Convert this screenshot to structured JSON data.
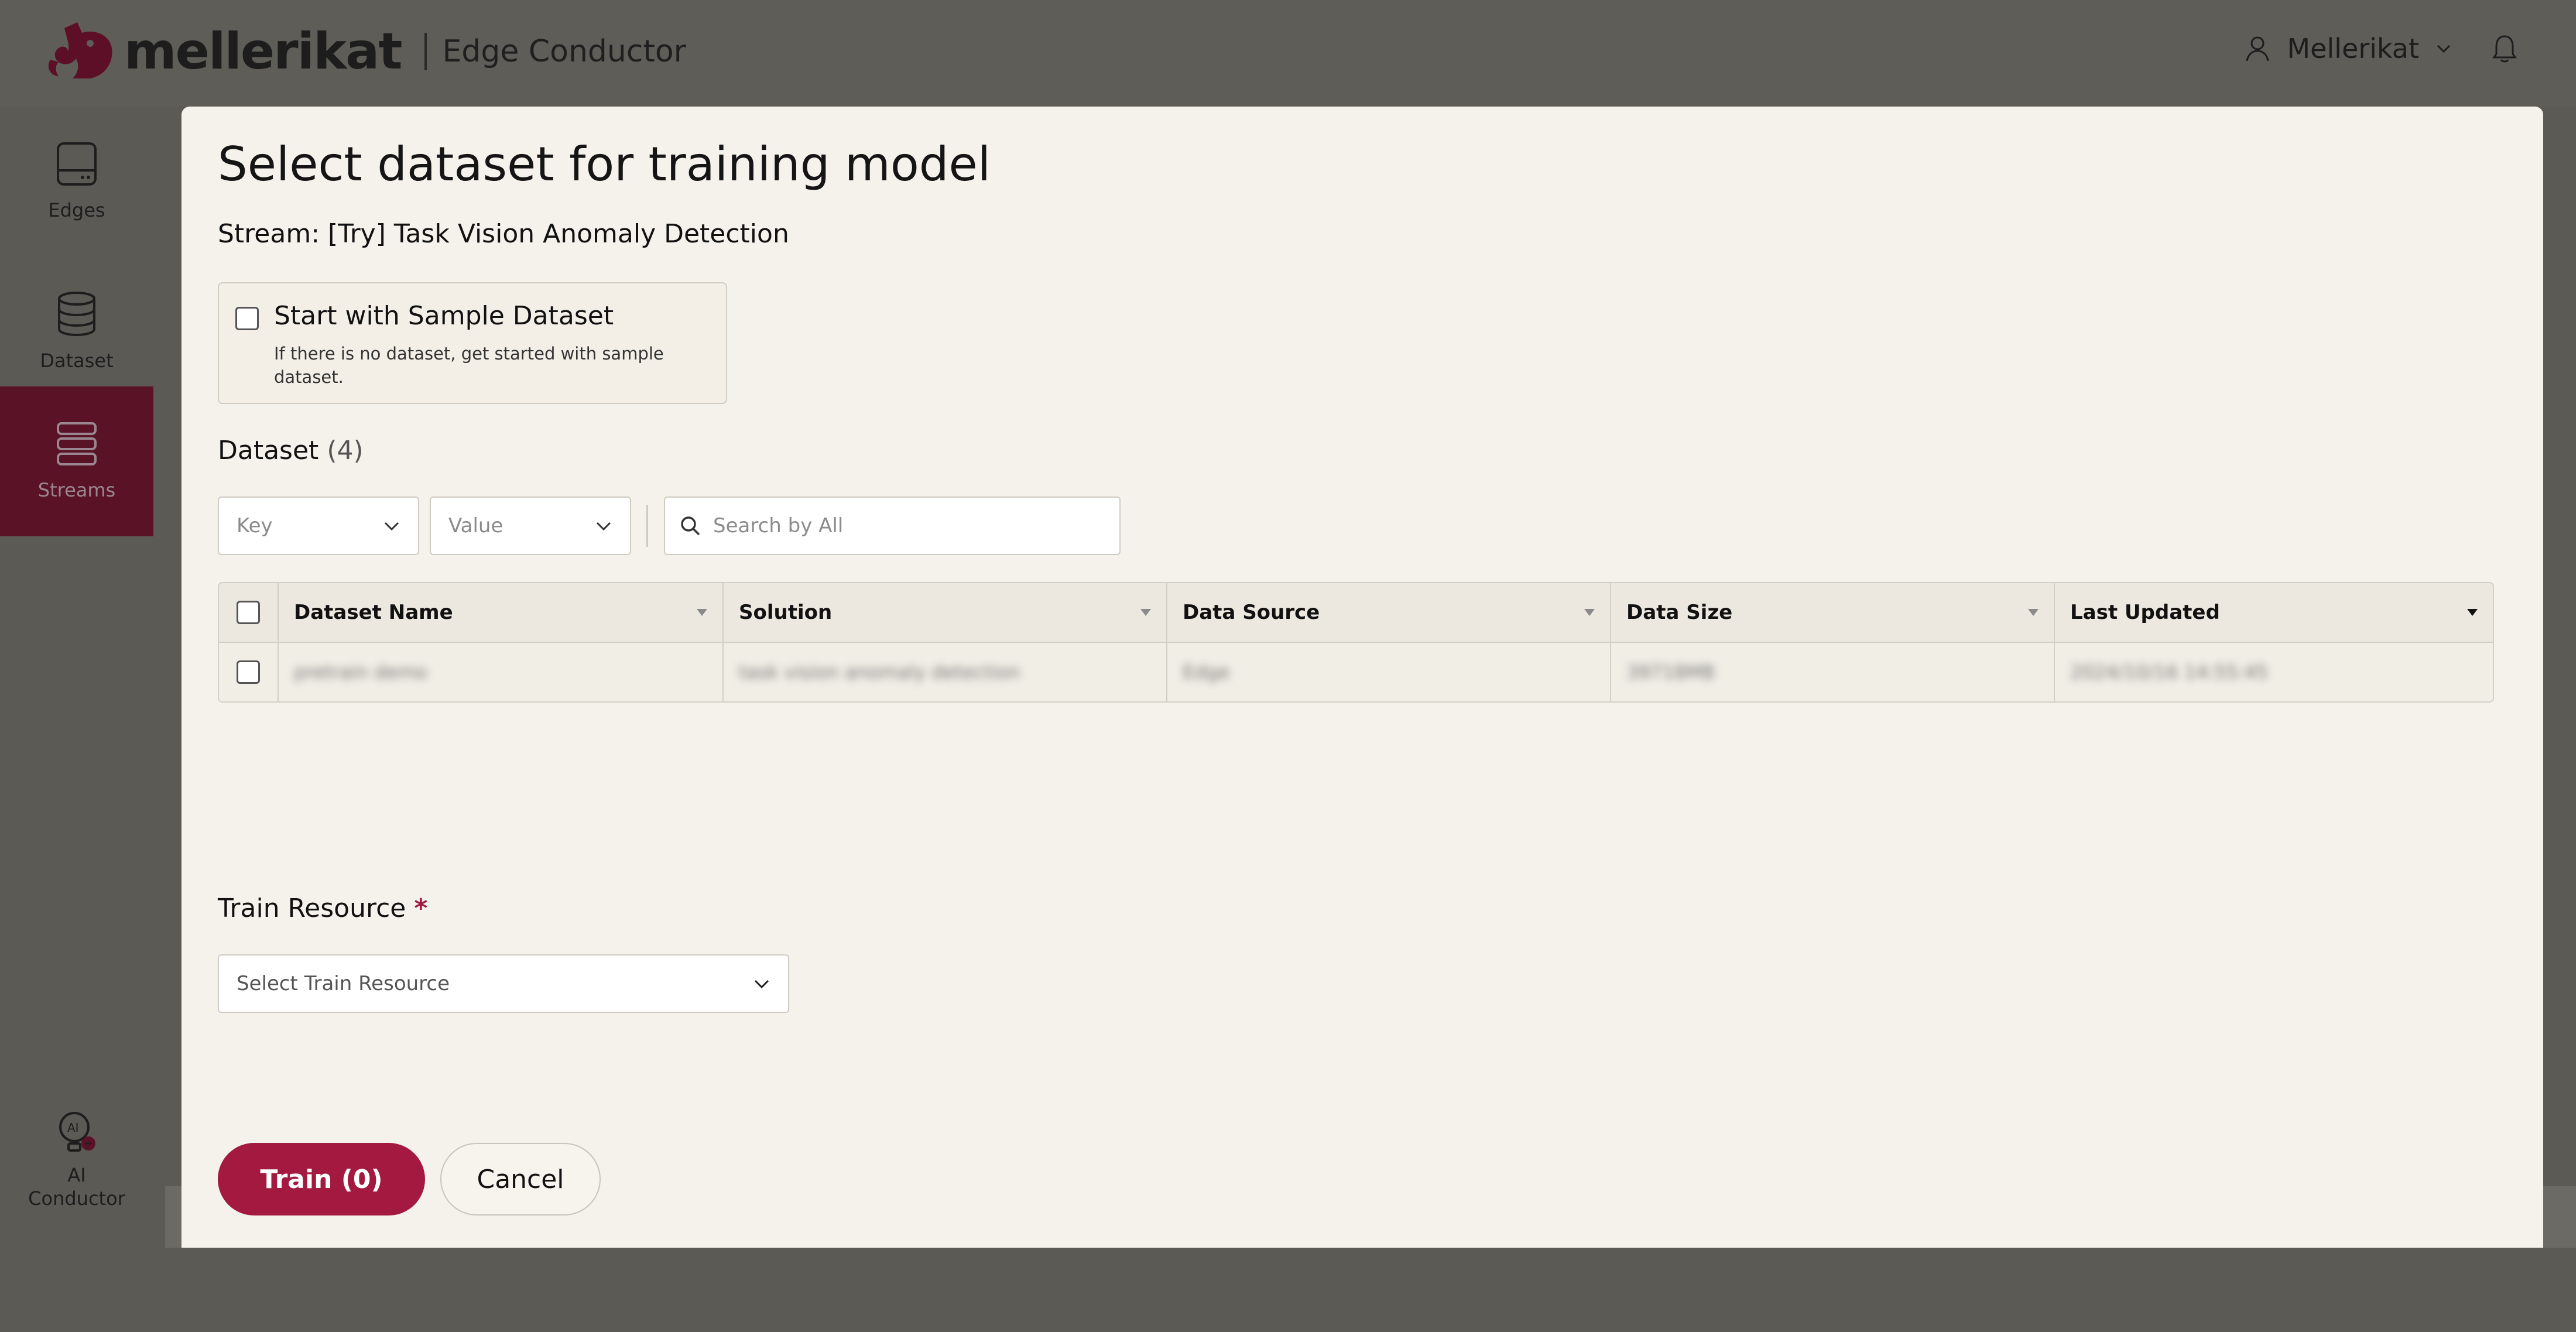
{
  "header": {
    "brand": "mellerikat",
    "product": "Edge Conductor",
    "user_name": "Mellerikat"
  },
  "sidebar": {
    "items": [
      {
        "label": "Edges",
        "icon": "edge-device-icon",
        "active": false
      },
      {
        "label": "Dataset",
        "icon": "database-icon",
        "active": false
      },
      {
        "label": "Streams",
        "icon": "streams-icon",
        "active": true
      }
    ],
    "ai_conductor": {
      "label_line1": "AI",
      "label_line2": "Conductor",
      "icon": "ai-bulb-icon"
    }
  },
  "modal": {
    "title": "Select dataset for training model",
    "stream_line": "Stream: [Try] Task Vision Anomaly Detection",
    "sample": {
      "title": "Start with Sample Dataset",
      "description": "If there is no dataset, get started with sample dataset.",
      "checked": false
    },
    "dataset_heading": "Dataset",
    "dataset_count": "(4)",
    "filters": {
      "key_placeholder": "Key",
      "value_placeholder": "Value",
      "search_placeholder": "Search by All"
    },
    "table": {
      "columns": [
        "Dataset Name",
        "Solution",
        "Data Source",
        "Data Size",
        "Last Updated"
      ],
      "rows": [
        [
          "pretrain demo",
          "task vision anomaly detection",
          "Edge",
          "39718MB",
          "2024/10/16 14:55:45"
        ]
      ]
    },
    "train_resource": {
      "label": "Train Resource",
      "required_mark": "*",
      "placeholder": "Select Train Resource"
    },
    "buttons": {
      "train": "Train (0)",
      "cancel": "Cancel"
    }
  },
  "colors": {
    "accent": "#a3193f",
    "sidebar_active": "#5a1226",
    "modal_bg": "#f5f2eb",
    "overlay": "#5b5a55"
  }
}
